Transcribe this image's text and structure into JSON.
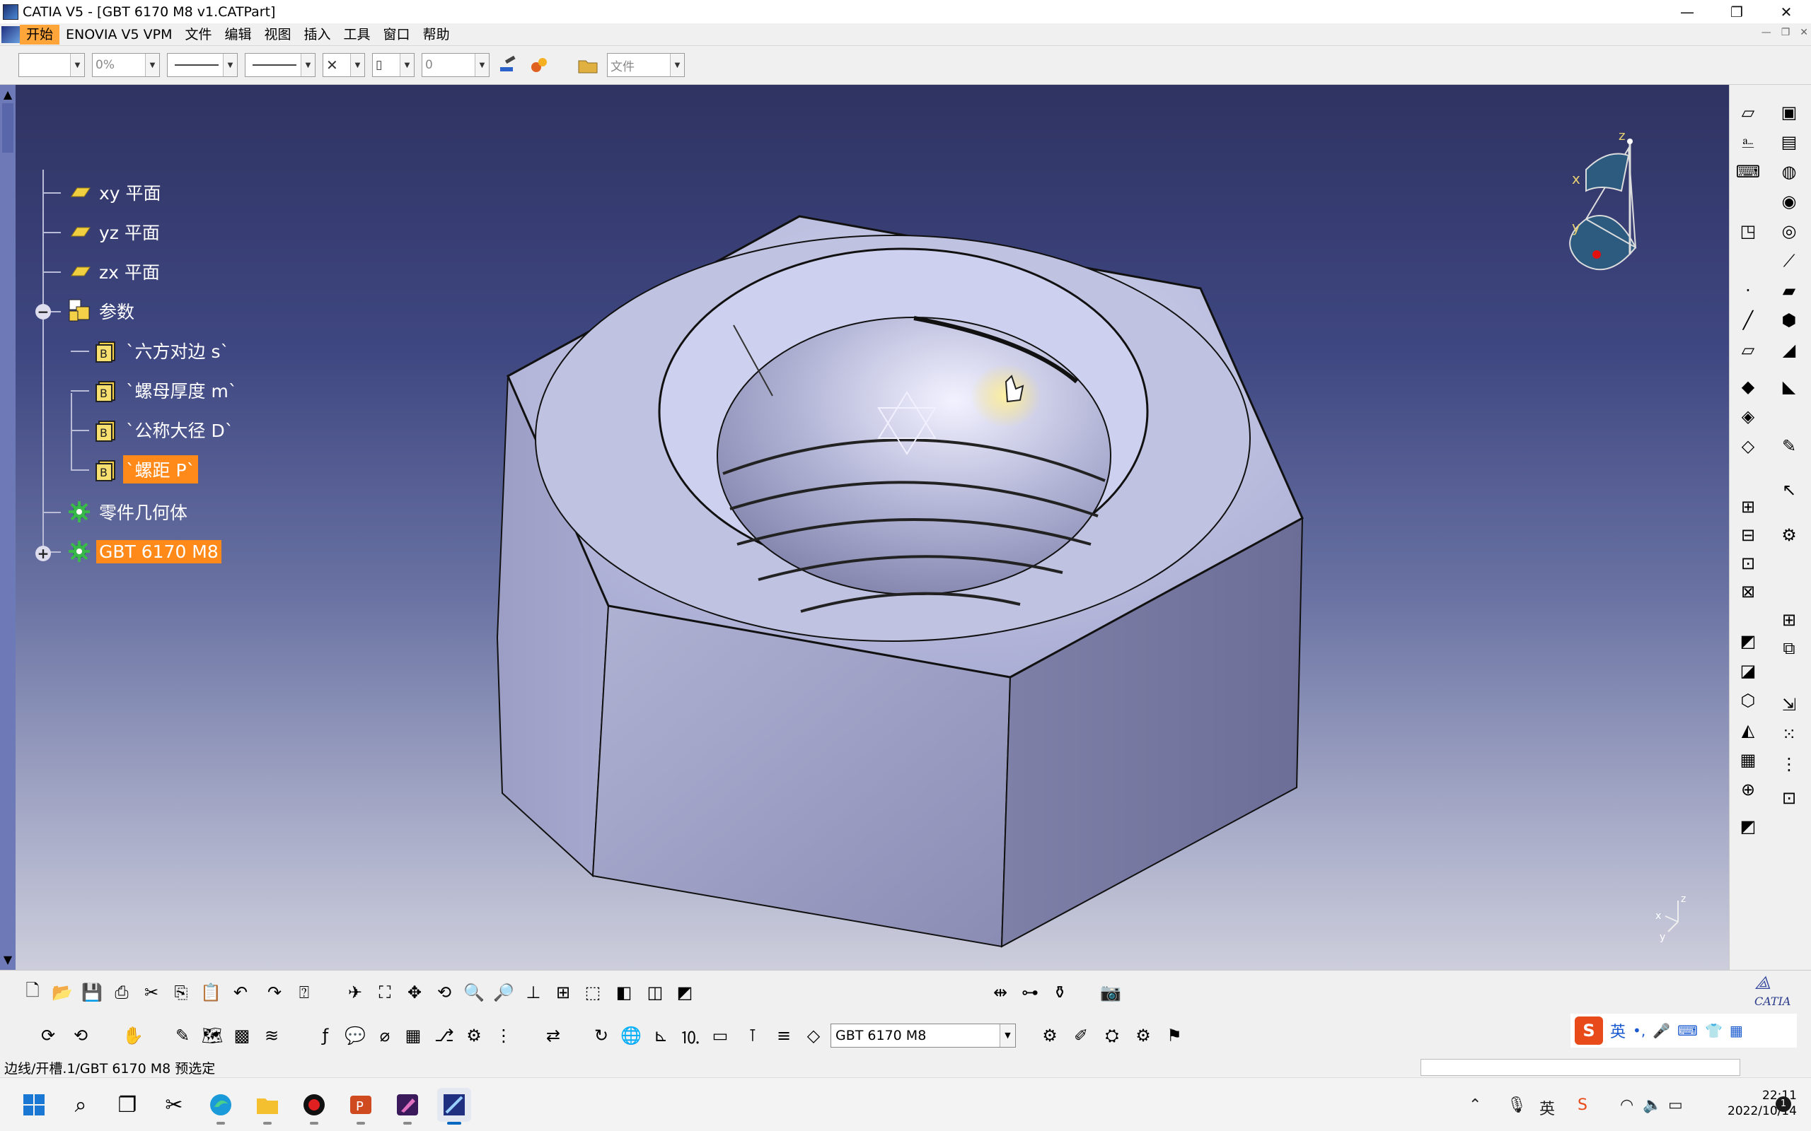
{
  "window": {
    "title": "CATIA V5 - [GBT 6170 M8 v1.CATPart]",
    "controls": {
      "minimize": "—",
      "maximize": "❐",
      "close": "✕"
    }
  },
  "menu": {
    "items": [
      "开始",
      "ENOVIA V5 VPM",
      "文件",
      "编辑",
      "视图",
      "插入",
      "工具",
      "窗口",
      "帮助"
    ],
    "active": "开始"
  },
  "format_toolbar": {
    "transparency": "0%",
    "layer": "0",
    "open_label": "文件"
  },
  "tree": {
    "nodes": [
      {
        "label": "xy 平面",
        "icon": "plane-icon"
      },
      {
        "label": "yz 平面",
        "icon": "plane-icon"
      },
      {
        "label": "zx 平面",
        "icon": "plane-icon"
      },
      {
        "label": "参数",
        "icon": "parameters-icon",
        "expander": "−"
      },
      {
        "label": "`六方对边 s`",
        "icon": "formula-icon"
      },
      {
        "label": "`螺母厚度 m`",
        "icon": "formula-icon"
      },
      {
        "label": "`公称大径 D`",
        "icon": "formula-icon"
      },
      {
        "label": "`螺距 P`",
        "icon": "formula-icon",
        "selected": true
      },
      {
        "label": "零件几何体",
        "icon": "part-body-icon"
      },
      {
        "label": "GBT 6170 M8",
        "icon": "part-body-icon",
        "selected": true,
        "expander": "+"
      }
    ]
  },
  "compass": {
    "x": "x",
    "y": "y",
    "z": "z"
  },
  "mini_axis": {
    "x": "x",
    "y": "y",
    "z": "z"
  },
  "part_selector": {
    "value": "GBT 6170 M8"
  },
  "status": {
    "text": "边线/开槽.1/GBT 6170 M8 预选定"
  },
  "ime": {
    "lang": "英"
  },
  "catia_logo": "CATIA",
  "clock": {
    "time": "22:11",
    "date": "2022/10/14"
  },
  "notifications": "1",
  "colors": {
    "selection": "#ff8a1a",
    "viewport_top": "#2f3362",
    "viewport_bottom": "#cdcedc",
    "active_menu": "#ffa53a"
  }
}
